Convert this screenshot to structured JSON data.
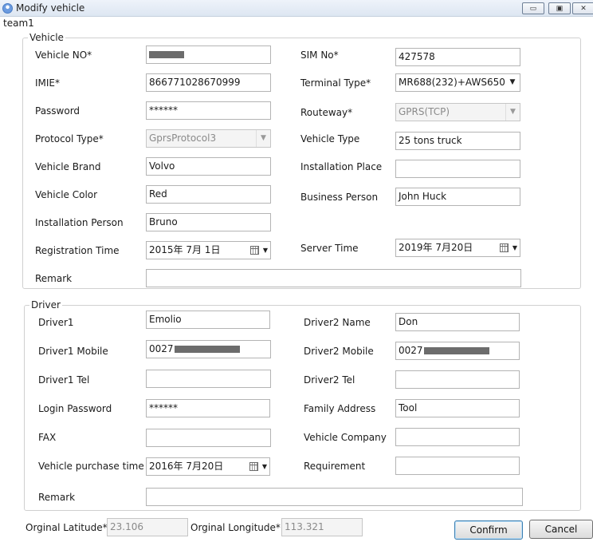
{
  "window": {
    "title": "Modify vehicle",
    "min_glyph": "▭",
    "max_glyph": "▣",
    "close_glyph": "✕"
  },
  "team": "team1",
  "vehicle": {
    "legend": "Vehicle",
    "vehicle_no": {
      "label": "Vehicle NO*"
    },
    "sim_no": {
      "label": "SIM No*",
      "value": "427578"
    },
    "imie": {
      "label": "IMIE*",
      "value": "866771028670999"
    },
    "terminal_type": {
      "label": "Terminal Type*",
      "value": "MR688(232)+AWS650"
    },
    "password": {
      "label": "Password",
      "value": "******"
    },
    "routeway": {
      "label": "Routeway*",
      "value": "GPRS(TCP)"
    },
    "protocol_type": {
      "label": "Protocol Type*",
      "value": "GprsProtocol3"
    },
    "vehicle_type": {
      "label": "Vehicle Type",
      "value": "25 tons truck"
    },
    "vehicle_brand": {
      "label": "Vehicle Brand",
      "value": "Volvo"
    },
    "installation_place": {
      "label": "Installation Place",
      "value": ""
    },
    "vehicle_color": {
      "label": "Vehicle Color",
      "value": "Red"
    },
    "business_person": {
      "label": "Business Person",
      "value": "John Huck"
    },
    "installation_person": {
      "label": "Installation Person",
      "value": "Bruno"
    },
    "registration_time": {
      "label": "Registration Time",
      "value": "2015年  7月  1日"
    },
    "server_time": {
      "label": "Server Time",
      "value": "2019年  7月20日"
    },
    "remark": {
      "label": "Remark",
      "value": ""
    }
  },
  "driver": {
    "legend": "Driver",
    "driver1": {
      "label": "Driver1",
      "value": "Emolio"
    },
    "driver2_name": {
      "label": "Driver2 Name",
      "value": "Don"
    },
    "driver1_mobile": {
      "label": "Driver1 Mobile",
      "value": "0027"
    },
    "driver2_mobile": {
      "label": "Driver2 Mobile",
      "value": "0027"
    },
    "driver1_tel": {
      "label": "Driver1 Tel",
      "value": ""
    },
    "driver2_tel": {
      "label": "Driver2 Tel",
      "value": ""
    },
    "login_password": {
      "label": "Login Password",
      "value": "******"
    },
    "family_address": {
      "label": "Family Address",
      "value": "Tool"
    },
    "fax": {
      "label": "FAX",
      "value": ""
    },
    "vehicle_company": {
      "label": "Vehicle Company",
      "value": ""
    },
    "vehicle_purchase_time": {
      "label": "Vehicle purchase time",
      "value": "2016年  7月20日"
    },
    "requirement": {
      "label": "Requirement",
      "value": ""
    },
    "remark": {
      "label": "Remark",
      "value": ""
    }
  },
  "footer": {
    "orig_latitude": {
      "label": "Orginal Latitude*",
      "value": "23.106"
    },
    "orig_longitude": {
      "label": "Orginal Longitude*",
      "value": "113.321"
    },
    "confirm_label": "Confirm",
    "cancel_label": "Cancel"
  },
  "icons": {
    "dropdown": "triangle-down",
    "calendar": "calendar-icon"
  }
}
